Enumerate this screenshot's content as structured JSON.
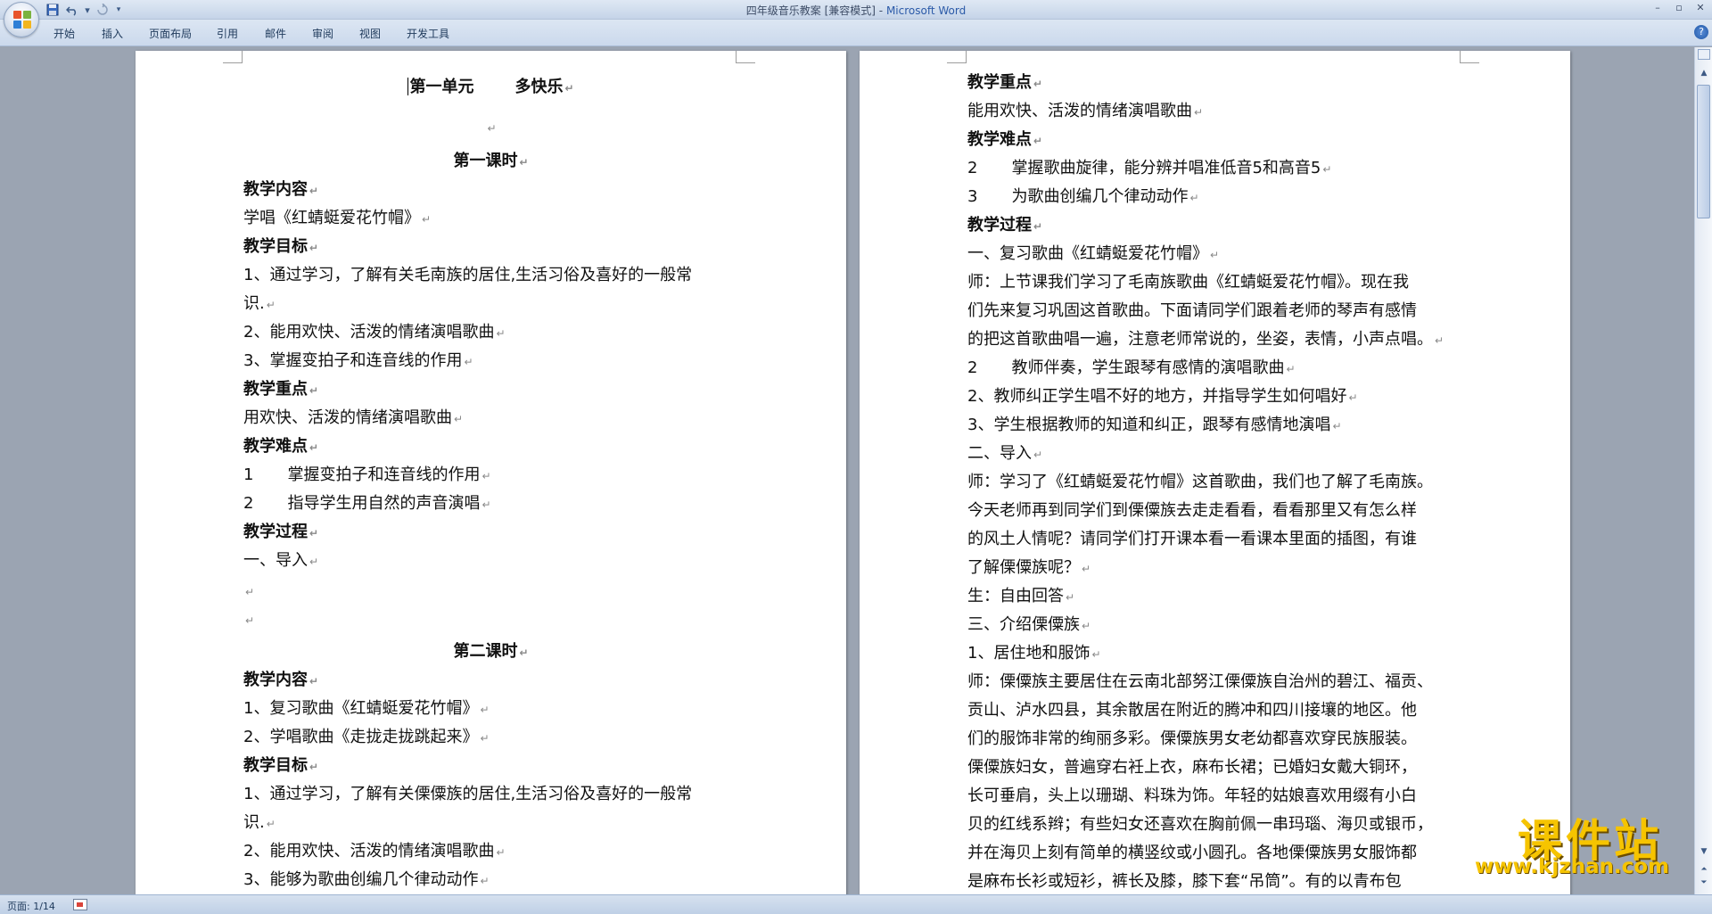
{
  "window": {
    "title": "四年级音乐教案 [兼容模式]",
    "title_sep": " - ",
    "app_name": "Microsoft Word"
  },
  "quick_access": [
    "save-icon",
    "undo-icon",
    "redo-icon",
    "customize-icon"
  ],
  "ribbon": {
    "tabs": [
      "开始",
      "插入",
      "页面布局",
      "引用",
      "邮件",
      "审阅",
      "视图",
      "开发工具"
    ]
  },
  "colors": {
    "accent": "#2b5aa8",
    "ribbon_bg": "#dce6f3",
    "workspace_bg": "#9ba4b2",
    "watermark": "#f6c400"
  },
  "document": {
    "left_page": {
      "unit_title": "第一单元",
      "unit_subtitle": "多快乐",
      "lesson1": {
        "title": "第一课时",
        "content_h": "教学内容",
        "content": "学唱《红蜻蜓爱花竹帽》",
        "goals_h": "教学目标",
        "goal1a": "1、通过学习，了解有关毛南族的居住,生活习俗及喜好的一般常",
        "goal1b": "识.",
        "goal2": "2、能用欢快、活泼的情绪演唱歌曲",
        "goal3": "3、掌握变拍子和连音线的作用",
        "key_h": "教学重点",
        "key": "用欢快、活泼的情绪演唱歌曲",
        "diff_h": "教学难点",
        "diff1_n": "1",
        "diff1": "掌握变拍子和连音线的作用",
        "diff2_n": "2",
        "diff2": "指导学生用自然的声音演唱",
        "proc_h": "教学过程",
        "proc1": "一、导入"
      },
      "lesson2": {
        "title": "第二课时",
        "content_h": "教学内容",
        "content1": "1、复习歌曲《红蜻蜓爱花竹帽》",
        "content2": "2、学唱歌曲《走拢走拢跳起来》",
        "goals_h": "教学目标",
        "goal1a": "1、通过学习，了解有关傈僳族的居住,生活习俗及喜好的一般常",
        "goal1b": "识.",
        "goal2": "2、能用欢快、活泼的情绪演唱歌曲",
        "goal3": "3、能够为歌曲创编几个律动动作"
      }
    },
    "right_page": {
      "key_h": "教学重点",
      "key": "能用欢快、活泼的情绪演唱歌曲",
      "diff_h": "教学难点",
      "diff1_n": "2",
      "diff1": "掌握歌曲旋律，能分辨并唱准低音5和高音5",
      "diff2_n": "3",
      "diff2": "为歌曲创编几个律动动作",
      "proc_h": "教学过程",
      "review": "一、复习歌曲《红蜻蜓爱花竹帽》",
      "t1a": "师：上节课我们学习了毛南族歌曲《红蜻蜓爱花竹帽》。现在我",
      "t1b": "们先来复习巩固这首歌曲。下面请同学们跟着老师的琴声有感情",
      "t1c": "的把这首歌曲唱一遍，注意老师常说的，坐姿，表情，小声点唱。",
      "s1_n": "2",
      "s1": "教师伴奏，学生跟琴有感情的演唱歌曲",
      "s2": "2、教师纠正学生唱不好的地方，并指导学生如何唱好",
      "s3": "3、学生根据教师的知道和纠正，跟琴有感情地演唱",
      "intro": "二、导入",
      "t2a": "师：学习了《红蜻蜓爱花竹帽》这首歌曲，我们也了解了毛南族。",
      "t2b": "今天老师再到同学们到傈僳族去走走看看，看看那里又有怎么样",
      "t2c": "的风土人情呢？请同学们打开课本看一看课本里面的插图，有谁",
      "t2d": "了解傈僳族呢？",
      "answer": "生：自由回答",
      "sec3": "三、介绍傈僳族",
      "sub1": "1、居住地和服饰",
      "p1": "师：傈僳族主要居住在云南北部努江傈僳族自治州的碧江、福贡、",
      "p2": "贡山、泸水四县，其余散居在附近的腾冲和四川接壤的地区。他",
      "p3": "们的服饰非常的绚丽多彩。傈僳族男女老幼都喜欢穿民族服装。",
      "p4": "傈僳族妇女，普遍穿右衽上衣，麻布长裙；已婚妇女戴大铜环，",
      "p5": "长可垂肩，头上以珊瑚、料珠为饰。年轻的姑娘喜欢用缀有小白",
      "p6": "贝的红线系辫；有些妇女还喜欢在胸前佩一串玛瑙、海贝或银币，",
      "p7": "并在海贝上刻有简单的横竖纹或小圆孔。各地傈僳族男女服饰都",
      "p8": "是麻布长衫或短衫，裤长及膝，膝下套“吊筒”。有的以青布包"
    }
  },
  "status": {
    "page": "页面: 1/14"
  },
  "watermark": {
    "main": "课件站",
    "url": "www.kjzhan.com"
  }
}
